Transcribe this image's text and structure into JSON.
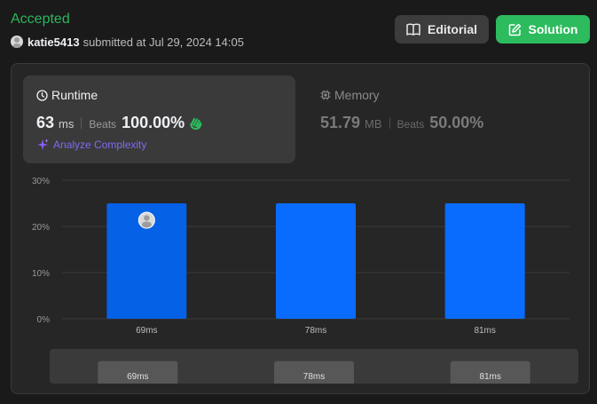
{
  "header": {
    "status": "Accepted",
    "username": "katie5413",
    "submitted_text": "submitted at Jul 29, 2024 14:05",
    "editorial_label": "Editorial",
    "solution_label": "Solution"
  },
  "runtime": {
    "title": "Runtime",
    "value": "63",
    "unit": "ms",
    "beats_label": "Beats",
    "beats_pct": "100.00%",
    "analyze_label": "Analyze Complexity"
  },
  "memory": {
    "title": "Memory",
    "value": "51.79",
    "unit": "MB",
    "beats_label": "Beats",
    "beats_pct": "50.00%"
  },
  "colors": {
    "accepted": "#2db55d",
    "solution_button": "#2cbb5d",
    "bar": "#0a6cff",
    "bar_selected": "#0561e6",
    "analyze": "#7c6cf2",
    "clap": "#2cbb5d"
  },
  "icons": {
    "editorial": "book-icon",
    "solution": "edit-icon",
    "runtime": "clock-icon",
    "memory": "chip-icon",
    "analyze": "sparkle-icon",
    "beats": "clap-icon"
  },
  "chart_data": {
    "type": "bar",
    "categories": [
      "69ms",
      "78ms",
      "81ms"
    ],
    "values": [
      25,
      25,
      25
    ],
    "ylim": [
      0,
      30
    ],
    "yticks": [
      "0%",
      "10%",
      "20%",
      "30%"
    ],
    "grid": true,
    "selected_index": 0
  },
  "mini_chart": {
    "categories": [
      "69ms",
      "78ms",
      "81ms"
    ],
    "values": [
      25,
      25,
      25
    ]
  }
}
